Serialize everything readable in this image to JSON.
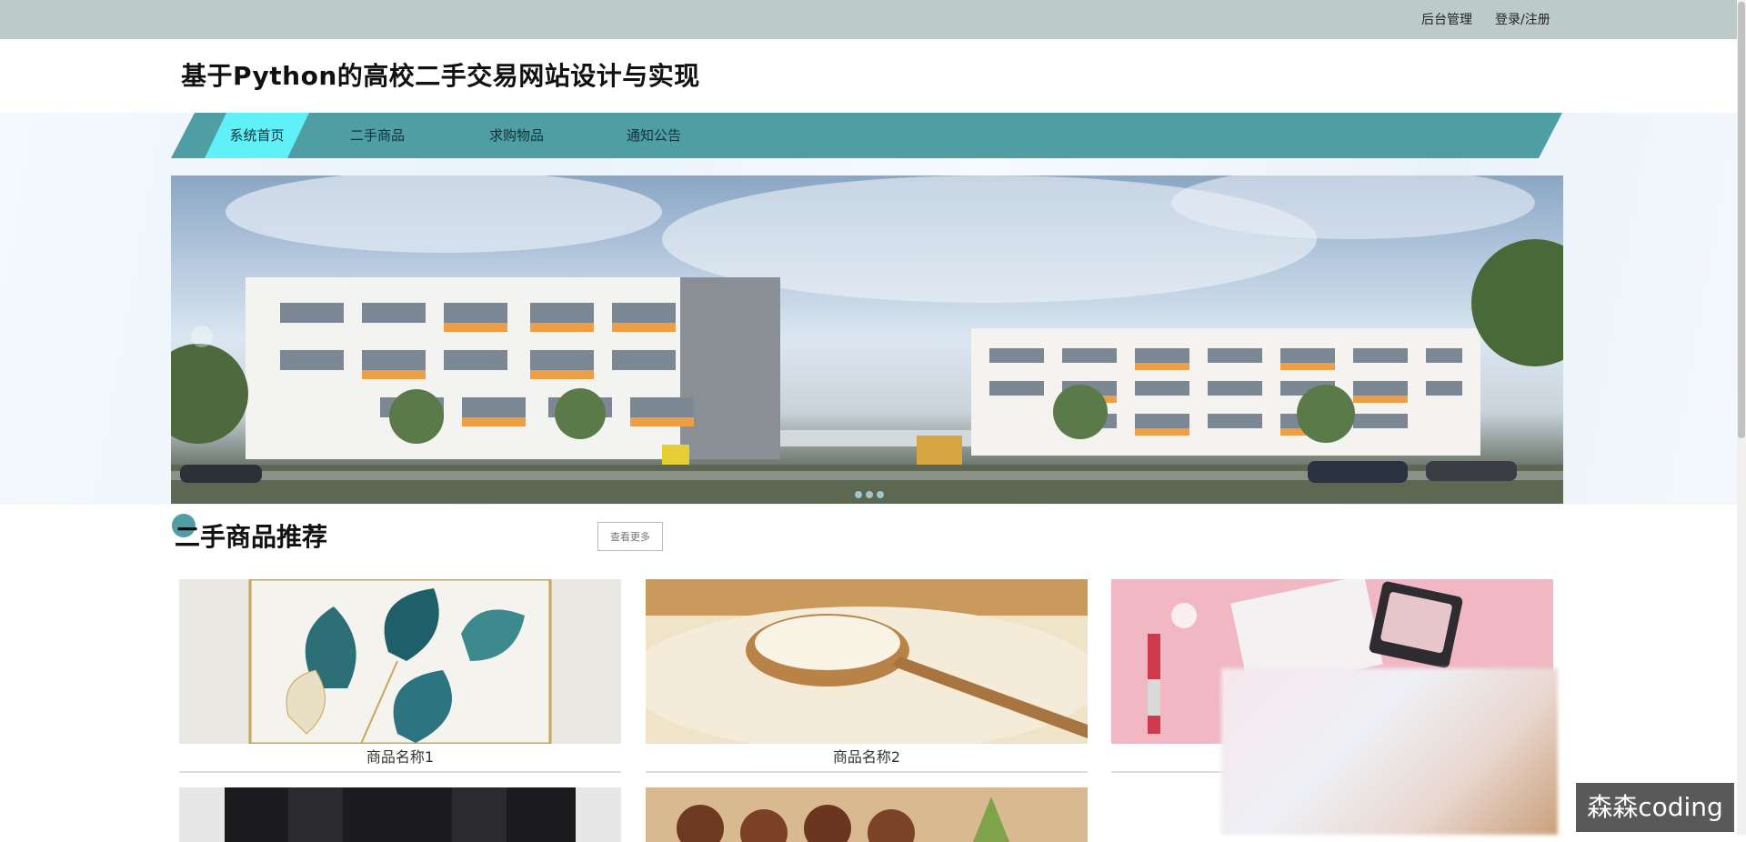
{
  "topbar": {
    "admin_label": "后台管理",
    "login_label": "登录/注册"
  },
  "header": {
    "site_title": "基于Python的高校二手交易网站设计与实现"
  },
  "nav": {
    "items": [
      {
        "label": "系统首页",
        "active": true
      },
      {
        "label": "二手商品",
        "active": false
      },
      {
        "label": "求购物品",
        "active": false
      },
      {
        "label": "通知公告",
        "active": false
      }
    ]
  },
  "section": {
    "title": "二手商品推荐",
    "more_label": "查看更多"
  },
  "products": [
    {
      "name": "商品名称1",
      "icon": "ginkgo-leaf-art-image"
    },
    {
      "name": "商品名称2",
      "icon": "rice-spoon-image"
    },
    {
      "name": "",
      "icon": "cosmetics-image"
    },
    {
      "name": "",
      "icon": "black-jacket-image"
    },
    {
      "name": "",
      "icon": "chestnuts-image"
    }
  ],
  "watermark": "森森coding",
  "colors": {
    "topbar": "#bccbca",
    "nav": "#4e9ea4",
    "nav_active": "#5ff0f8"
  }
}
